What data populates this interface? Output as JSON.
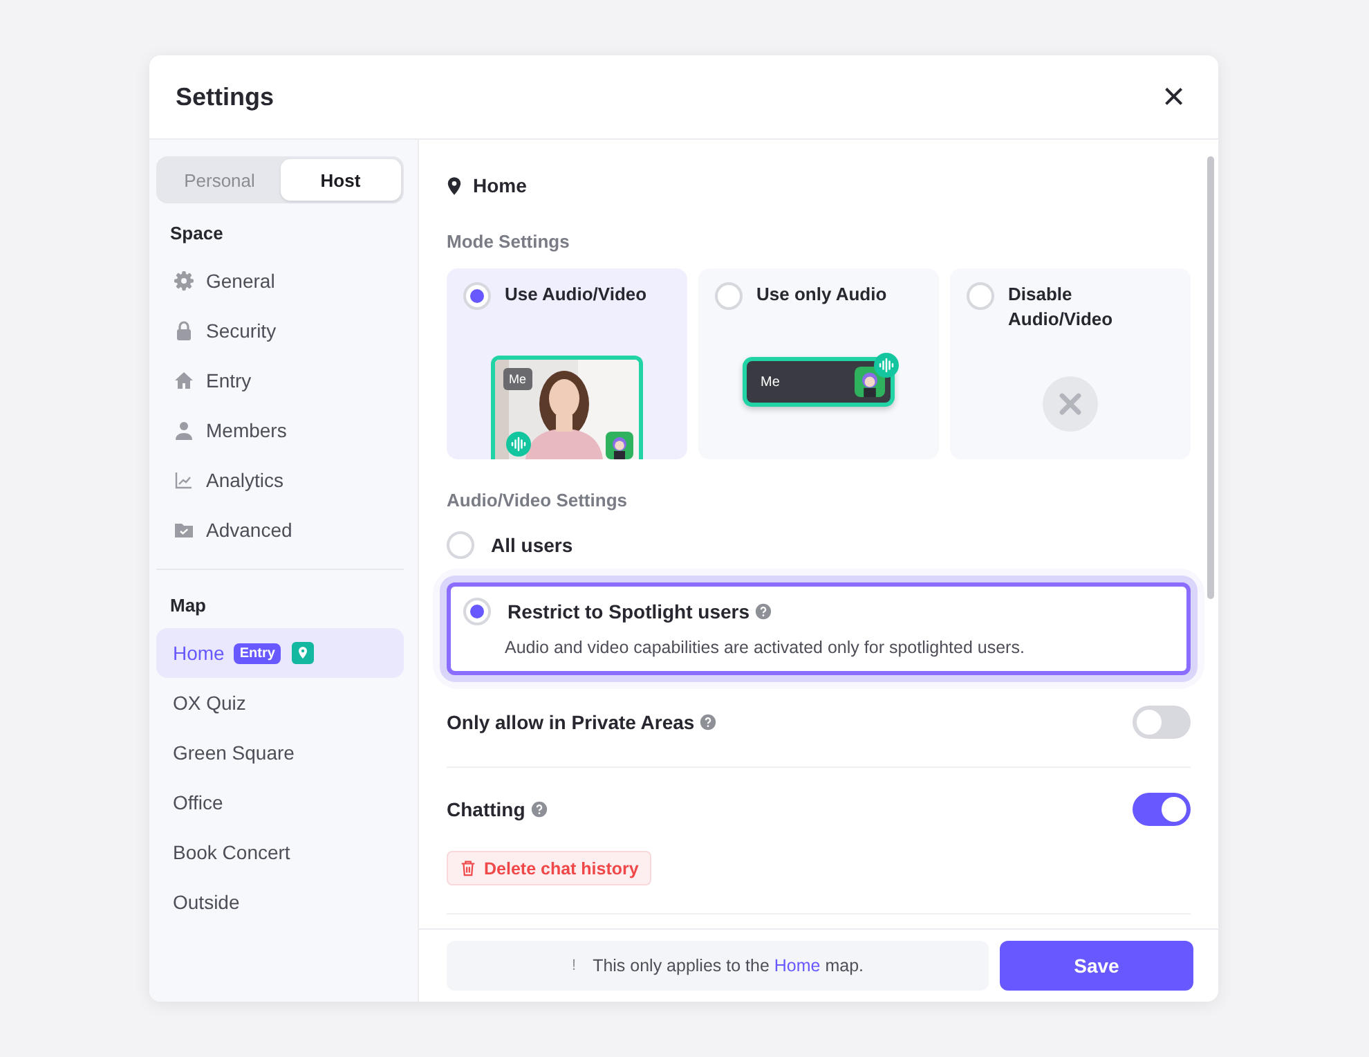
{
  "window": {
    "title": "Settings",
    "close": "×"
  },
  "role_tabs": [
    {
      "label": "Personal",
      "selected": false
    },
    {
      "label": "Host",
      "selected": true
    }
  ],
  "sidebar": {
    "space_heading": "Space",
    "space_items": [
      {
        "label": "General",
        "selected": false
      },
      {
        "label": "Security",
        "selected": false
      },
      {
        "label": "Entry",
        "selected": false
      },
      {
        "label": "Members",
        "selected": false
      },
      {
        "label": "Analytics",
        "selected": false
      },
      {
        "label": "Advanced",
        "selected": false
      }
    ],
    "map_heading": "Map",
    "map_items": [
      {
        "label": "Home",
        "selected": true,
        "badge": "Entry",
        "pin": true
      },
      {
        "label": "OX Quiz",
        "selected": false
      },
      {
        "label": "Green Square",
        "selected": false
      },
      {
        "label": "Office",
        "selected": false
      },
      {
        "label": "Book Concert",
        "selected": false
      },
      {
        "label": "Outside",
        "selected": false
      }
    ]
  },
  "content": {
    "map_title": "Home",
    "mode_heading": "Mode Settings",
    "modes": [
      {
        "label": "Use Audio/Video",
        "selected": true,
        "kind": "video",
        "tag": "Me"
      },
      {
        "label": "Use only Audio",
        "selected": false,
        "kind": "audio",
        "tag": "Me"
      },
      {
        "label": "Disable Audio/Video",
        "selected": false,
        "kind": "disabled"
      }
    ],
    "av_heading": "Audio/Video Settings",
    "av_options": [
      {
        "label": "All users",
        "selected": false,
        "help": false
      },
      {
        "label": "Restrict to Spotlight users",
        "selected": true,
        "help": true,
        "description": "Audio and video capabilities are activated only for spotlighted users."
      }
    ],
    "toggles": [
      {
        "label": "Only allow in Private Areas",
        "on": false
      },
      {
        "label": "Chatting",
        "on": true,
        "action": "Delete chat history"
      }
    ]
  },
  "footer": {
    "note_mark": "!",
    "note_before": "This only applies to the",
    "note_map": "Home",
    "note_after": "map.",
    "save": "Save"
  }
}
